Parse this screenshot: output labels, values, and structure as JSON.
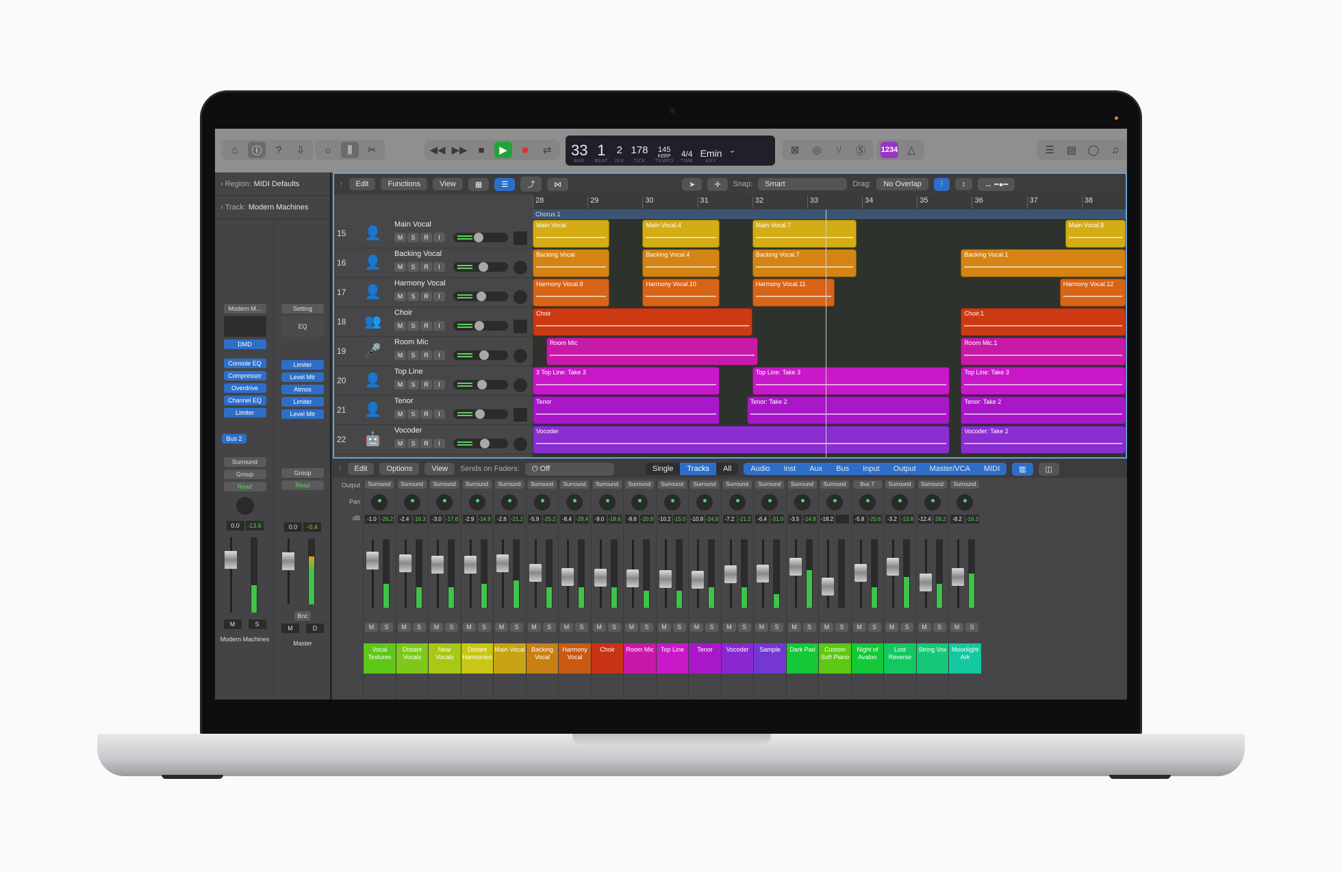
{
  "control_bar": {
    "left_icons": [
      "library-icon",
      "inspector-icon",
      "quick-help-icon",
      "download-icon"
    ],
    "mid_icons": [
      "brightness-icon",
      "mixer-icon",
      "scissors-icon"
    ],
    "transport": [
      "rewind-icon",
      "fast-forward-icon",
      "stop-icon",
      "play-icon",
      "record-icon",
      "cycle-icon"
    ],
    "lcd": {
      "bar": "33",
      "beat": "1",
      "div": "2",
      "tick": "178",
      "tempo": "145",
      "tempo_mode": "KEEP",
      "time_sig_num": "4",
      "time_sig_den": "4",
      "key": "Emin",
      "labels": {
        "bar": "BAR",
        "beat": "BEAT",
        "div": "DIV",
        "tick": "TICK",
        "tempo": "TEMPO",
        "time": "TIME",
        "key": "KEY"
      }
    },
    "count_in": "1234",
    "right_icons": [
      "list-icon",
      "note-pad-icon",
      "loop-browser-icon",
      "media-browser-icon"
    ]
  },
  "inspector": {
    "region_label": "Region:",
    "region_value": "MIDI Defaults",
    "track_label": "Track:",
    "track_value": "Modern Machines",
    "strip1": {
      "setting": "Modern M...",
      "plugins": [
        "DMD",
        "Console EQ",
        "Compressor",
        "Overdrive",
        "Channel EQ",
        "Limiter"
      ],
      "send": "Bus 2",
      "output": "Surround",
      "group": "Group",
      "automation": "Read",
      "vol": "0.0",
      "peak": "-13.6",
      "name": "Modern Machines",
      "m": "M",
      "s": "S"
    },
    "strip2": {
      "setting": "Setting",
      "eq": "EQ",
      "plugins": [
        "Limiter",
        "Level Mtr",
        "Atmos",
        "Limiter",
        "Level Mtr"
      ],
      "group": "Group",
      "automation": "Read",
      "vol": "0.0",
      "peak": "-0.4",
      "bounce": "Bnc",
      "name": "Master",
      "m": "M",
      "d": "D"
    }
  },
  "tracks_toolbar": {
    "edit": "Edit",
    "functions": "Functions",
    "view": "View",
    "snap_label": "Snap:",
    "snap_value": "Smart",
    "drag_label": "Drag:",
    "drag_value": "No Overlap"
  },
  "ruler": [
    "28",
    "29",
    "30",
    "31",
    "32",
    "33",
    "34",
    "35",
    "36",
    "37",
    "38"
  ],
  "marker": "Chorus 1",
  "tracks": [
    {
      "num": "15",
      "name": "Main Vocal",
      "color": "#e8b812",
      "icon": "person-mic-icon"
    },
    {
      "num": "16",
      "name": "Backing Vocal",
      "color": "#f09a18",
      "icon": "person-mic-icon"
    },
    {
      "num": "17",
      "name": "Harmony Vocal",
      "color": "#f07a18",
      "icon": "person-mic-icon"
    },
    {
      "num": "18",
      "name": "Choir",
      "color": "#f05a22",
      "icon": "choir-icon"
    },
    {
      "num": "19",
      "name": "Room Mic",
      "color": "#f040c8",
      "icon": "microphone-icon"
    },
    {
      "num": "20",
      "name": "Top Line",
      "color": "#f040d8",
      "icon": "person-mic-icon"
    },
    {
      "num": "21",
      "name": "Tenor",
      "color": "#e050e0",
      "icon": "person-mic-icon"
    },
    {
      "num": "22",
      "name": "Vocoder",
      "color": "#b050e8",
      "icon": "robot-icon"
    }
  ],
  "regions": [
    [
      {
        "name": "Main Vocal",
        "s": 0,
        "e": 1.4,
        "c": "#d4ac14"
      },
      {
        "name": "Main Vocal.4",
        "s": 2,
        "e": 3.4,
        "c": "#d4ac14"
      },
      {
        "name": "Main Vocal.7",
        "s": 4,
        "e": 5.9,
        "c": "#d4ac14"
      },
      {
        "name": "Main Vocal.8",
        "s": 9.7,
        "e": 10.8,
        "c": "#d4ac14"
      }
    ],
    [
      {
        "name": "Backing Vocal",
        "s": 0,
        "e": 1.4,
        "c": "#d48414"
      },
      {
        "name": "Backing Vocal.4",
        "s": 2,
        "e": 3.4,
        "c": "#d48414"
      },
      {
        "name": "Backing Vocal.7",
        "s": 4,
        "e": 5.9,
        "c": "#d48414"
      },
      {
        "name": "Backing Vocal.1",
        "s": 7.8,
        "e": 10.8,
        "c": "#d48414"
      }
    ],
    [
      {
        "name": "Harmony Vocal.9",
        "s": 0,
        "e": 1.4,
        "c": "#d86418"
      },
      {
        "name": "Harmony Vocal.10",
        "s": 2,
        "e": 3.4,
        "c": "#d86418"
      },
      {
        "name": "Harmony Vocal.11",
        "s": 4,
        "e": 5.5,
        "c": "#d86418"
      },
      {
        "name": "Harmony Vocal.12",
        "s": 9.6,
        "e": 10.8,
        "c": "#d86418"
      }
    ],
    [
      {
        "name": "Choir",
        "s": 0,
        "e": 4,
        "c": "#cc3a14"
      },
      {
        "name": "Choir.1",
        "s": 7.8,
        "e": 10.8,
        "c": "#cc3a14"
      }
    ],
    [
      {
        "name": "Room Mic",
        "s": 0.25,
        "e": 4.1,
        "c": "#c81aa8"
      },
      {
        "name": "Room Mic.1",
        "s": 7.8,
        "e": 10.8,
        "c": "#c81aa8"
      }
    ],
    [
      {
        "name": "3  Top Line: Take 3",
        "s": 0,
        "e": 3.4,
        "c": "#c818c8"
      },
      {
        "name": "Top Line: Take 3",
        "s": 4,
        "e": 7.6,
        "c": "#c818c8"
      },
      {
        "name": "Top Line: Take 3",
        "s": 7.8,
        "e": 10.8,
        "c": "#c818c8"
      }
    ],
    [
      {
        "name": "Tenor",
        "s": 0,
        "e": 3.4,
        "c": "#a818c8"
      },
      {
        "name": "Tenor: Take 2",
        "s": 3.9,
        "e": 7.6,
        "c": "#a818c8"
      },
      {
        "name": "Tenor: Take 2",
        "s": 7.8,
        "e": 10.8,
        "c": "#a818c8"
      }
    ],
    [
      {
        "name": "Vocoder",
        "s": 0,
        "e": 7.6,
        "c": "#8a2ed0"
      },
      {
        "name": "Vocoder: Take 2",
        "s": 7.8,
        "e": 10.8,
        "c": "#8a2ed0"
      }
    ]
  ],
  "mixer_toolbar": {
    "edit": "Edit",
    "options": "Options",
    "view": "View",
    "sends_label": "Sends on Faders:",
    "sends_value": "Off",
    "modes": [
      "Single",
      "Tracks",
      "All"
    ],
    "active_mode": "Tracks",
    "filters": [
      "Audio",
      "Inst",
      "Aux",
      "Bus",
      "Input",
      "Output",
      "Master/VCA",
      "MIDI"
    ]
  },
  "mixer_labels": {
    "output": "Output",
    "pan": "Pan",
    "db": "dB"
  },
  "channels": [
    {
      "out": "Surround",
      "vol": "-1.0",
      "peak": "-26.2",
      "name": "Vocal Textures",
      "color": "#5ec81a",
      "lvl": 0.35,
      "fader": 0.78
    },
    {
      "out": "Surround",
      "vol": "-2.4",
      "peak": "-16.3",
      "name": "Distant Vocals",
      "color": "#7ec81a",
      "lvl": 0.3,
      "fader": 0.72
    },
    {
      "out": "Surround",
      "vol": "-3.0",
      "peak": "-17.6",
      "name": "Near Vocals",
      "color": "#a8c814",
      "lvl": 0.3,
      "fader": 0.7
    },
    {
      "out": "Surround",
      "vol": "-2.9",
      "peak": "-14.9",
      "name": "Distant Harmonies",
      "color": "#c8c814",
      "lvl": 0.35,
      "fader": 0.7
    },
    {
      "out": "Surround",
      "vol": "-2.6",
      "peak": "-21.2",
      "name": "Main Vocal",
      "color": "#c8a414",
      "lvl": 0.4,
      "fader": 0.72
    },
    {
      "out": "Surround",
      "vol": "-5.9",
      "peak": "-25.2",
      "name": "Backing Vocal",
      "color": "#c88014",
      "lvl": 0.3,
      "fader": 0.55
    },
    {
      "out": "Surround",
      "vol": "-8.4",
      "peak": "-28.4",
      "name": "Harmony Vocal",
      "color": "#c85a14",
      "lvl": 0.3,
      "fader": 0.48
    },
    {
      "out": "Surround",
      "vol": "-9.0",
      "peak": "-18.6",
      "name": "Choir",
      "color": "#c83414",
      "lvl": 0.3,
      "fader": 0.46
    },
    {
      "out": "Surround",
      "vol": "-9.6",
      "peak": "-20.9",
      "name": "Room Mic",
      "color": "#c818a8",
      "lvl": 0.25,
      "fader": 0.45
    },
    {
      "out": "Surround",
      "vol": "-10.2",
      "peak": "-15.0",
      "name": "Top Line",
      "color": "#c818c8",
      "lvl": 0.25,
      "fader": 0.44
    },
    {
      "out": "Surround",
      "vol": "-10.8",
      "peak": "-24.9",
      "name": "Tenor",
      "color": "#a818c8",
      "lvl": 0.3,
      "fader": 0.42
    },
    {
      "out": "Surround",
      "vol": "-7.2",
      "peak": "-21.2",
      "name": "Vocoder",
      "color": "#8a28d0",
      "lvl": 0.3,
      "fader": 0.52
    },
    {
      "out": "Surround",
      "vol": "-6.4",
      "peak": "-31.0",
      "name": "Sample",
      "color": "#7438d0",
      "lvl": 0.2,
      "fader": 0.54
    },
    {
      "out": "Surround",
      "vol": "-3.5",
      "peak": "-14.8",
      "name": "Dark Pad",
      "color": "#14c838",
      "lvl": 0.55,
      "fader": 0.66
    },
    {
      "out": "Surround",
      "vol": "-18.2",
      "peak": "",
      "name": "Custom Soft Piano",
      "color": "#5ec814",
      "lvl": 0,
      "fader": 0.3
    },
    {
      "out": "Bus 7",
      "vol": "-5.8",
      "peak": "-20.6",
      "name": "Night of Avalon",
      "color": "#14c838",
      "lvl": 0.3,
      "fader": 0.55
    },
    {
      "out": "Surround",
      "vol": "-3.2",
      "peak": "-13.8",
      "name": "Lost Reverse",
      "color": "#14c860",
      "lvl": 0.45,
      "fader": 0.66
    },
    {
      "out": "Surround",
      "vol": "-12.4",
      "peak": "-28.2",
      "name": "String Vox",
      "color": "#14c878",
      "lvl": 0.35,
      "fader": 0.38
    },
    {
      "out": "Surround",
      "vol": "-8.2",
      "peak": "-16.3",
      "name": "Moonlight Ark",
      "color": "#14c8a0",
      "lvl": 0.5,
      "fader": 0.48
    }
  ],
  "strip_buttons": {
    "m": "M",
    "s": "S",
    "r": "R",
    "i": "I"
  }
}
